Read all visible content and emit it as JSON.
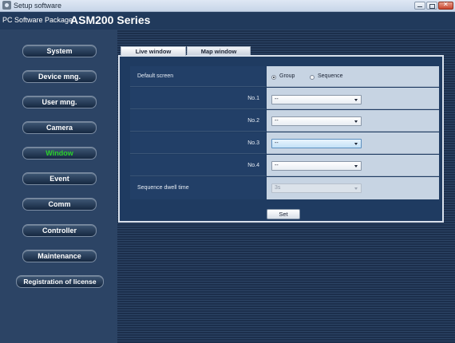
{
  "window": {
    "title": "Setup software",
    "icon": "app-icon"
  },
  "header": {
    "package_label": "PC Software Package",
    "series_label": "ASM200 Series"
  },
  "sidebar": {
    "items": [
      {
        "label": "System"
      },
      {
        "label": "Device mng."
      },
      {
        "label": "User mng."
      },
      {
        "label": "Camera"
      },
      {
        "label": "Window",
        "active": true
      },
      {
        "label": "Event"
      },
      {
        "label": "Comm"
      },
      {
        "label": "Controller"
      },
      {
        "label": "Maintenance"
      },
      {
        "label": "Registration of license"
      }
    ],
    "active_color": "#2bd12b"
  },
  "tabs": [
    {
      "label": "Live window",
      "selected": true
    },
    {
      "label": "Map window",
      "selected": false
    }
  ],
  "form": {
    "default_screen": {
      "label": "Default screen",
      "options": [
        "Group",
        "Sequence"
      ],
      "selected": "Group"
    },
    "slots": [
      {
        "label": "No.1",
        "value": "--"
      },
      {
        "label": "No.2",
        "value": "--"
      },
      {
        "label": "No.3",
        "value": "--",
        "focused": true
      },
      {
        "label": "No.4",
        "value": "--"
      }
    ],
    "dwell": {
      "label": "Sequence dwell time",
      "value": "3s",
      "disabled": true
    },
    "set_label": "Set"
  },
  "colors": {
    "background": "#1e2f4a",
    "panel": "#1f3b61",
    "row_right": "#c7d4e3"
  }
}
